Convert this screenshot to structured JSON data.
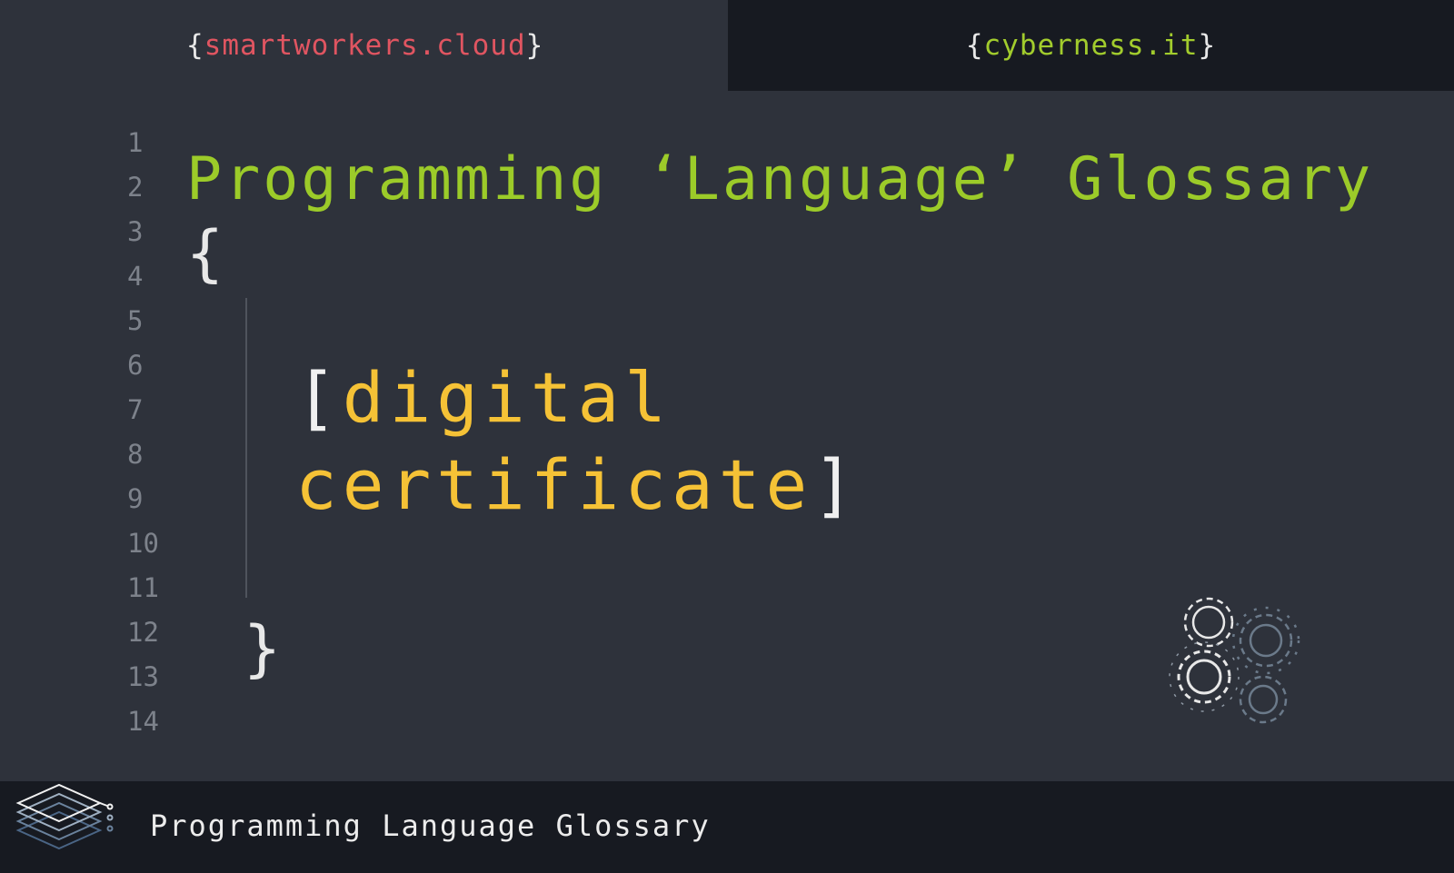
{
  "tabs": [
    {
      "open": "{",
      "label": "smartworkers.cloud",
      "close": "}"
    },
    {
      "open": "{",
      "label": "cyberness.it",
      "close": "}"
    }
  ],
  "line_numbers": [
    "1",
    "2",
    "3",
    "4",
    "5",
    "6",
    "7",
    "8",
    "9",
    "10",
    "11",
    "12",
    "13",
    "14"
  ],
  "editor": {
    "title": "Programming ‘Language’ Glossary",
    "open_brace": "{",
    "term_open": "[",
    "term_line1": "digital",
    "term_line2": "certificate",
    "term_close": "]",
    "close_brace": "}"
  },
  "footer": {
    "title": "Programming Language Glossary"
  },
  "icons": {
    "logo": "stacked-layers-icon",
    "gears": "gears-icon"
  },
  "colors": {
    "background": "#2e323b",
    "tab_inactive": "#171a21",
    "red_accent": "#e05561",
    "green_accent": "#a2cc2d",
    "yellow_accent": "#f5c236"
  }
}
